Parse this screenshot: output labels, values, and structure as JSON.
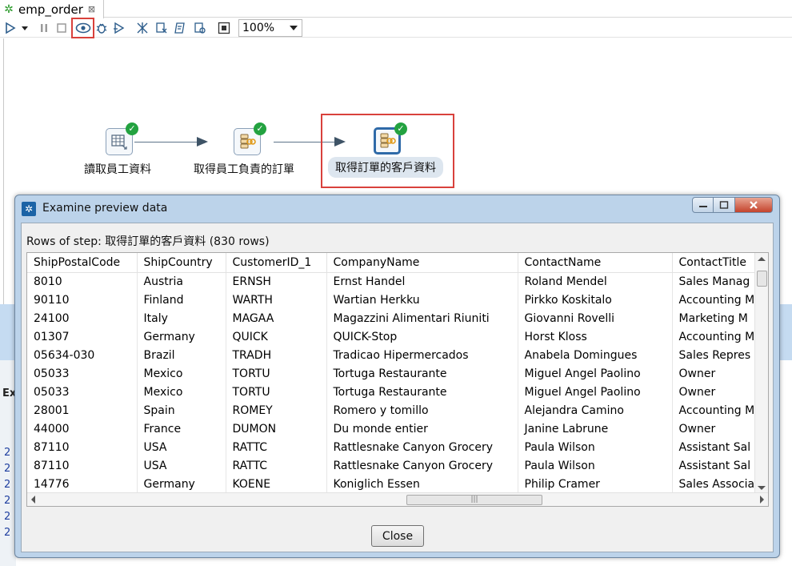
{
  "tab": {
    "title": "emp_order",
    "close": "⊠"
  },
  "toolbar": {
    "zoom": "100%"
  },
  "steps": [
    {
      "label": "讀取員工資料"
    },
    {
      "label": "取得員工負責的訂單"
    },
    {
      "label": "取得訂單的客戶資料"
    }
  ],
  "side_panel": {
    "letters": [
      "Ex",
      "2",
      "2",
      "2",
      "2",
      "2",
      "2"
    ]
  },
  "dialog": {
    "title": "Examine preview data",
    "rows_label": "Rows of step: 取得訂單的客戶資料 (830 rows)",
    "close_label": "Close",
    "columns": [
      "ShipPostalCode",
      "ShipCountry",
      "CustomerID_1",
      "CompanyName",
      "ContactName",
      "ContactTitle"
    ],
    "rows": [
      [
        "8010",
        "Austria",
        "ERNSH",
        "Ernst Handel",
        "Roland Mendel",
        "Sales Manag"
      ],
      [
        "90110",
        "Finland",
        "WARTH",
        "Wartian Herkku",
        "Pirkko Koskitalo",
        "Accounting M"
      ],
      [
        "24100",
        "Italy",
        "MAGAA",
        "Magazzini Alimentari Riuniti",
        "Giovanni Rovelli",
        "Marketing M"
      ],
      [
        "01307",
        "Germany",
        "QUICK",
        "QUICK-Stop",
        "Horst Kloss",
        "Accounting M"
      ],
      [
        "05634-030",
        "Brazil",
        "TRADH",
        "Tradicao Hipermercados",
        "Anabela Domingues",
        "Sales Repres"
      ],
      [
        "05033",
        "Mexico",
        "TORTU",
        "Tortuga Restaurante",
        "Miguel Angel Paolino",
        "Owner"
      ],
      [
        "05033",
        "Mexico",
        "TORTU",
        "Tortuga Restaurante",
        "Miguel Angel Paolino",
        "Owner"
      ],
      [
        "28001",
        "Spain",
        "ROMEY",
        "Romero y tomillo",
        "Alejandra Camino",
        "Accounting M"
      ],
      [
        "44000",
        "France",
        "DUMON",
        "Du monde entier",
        "Janine Labrune",
        "Owner"
      ],
      [
        "87110",
        "USA",
        "RATTC",
        "Rattlesnake Canyon Grocery",
        "Paula Wilson",
        "Assistant Sal"
      ],
      [
        "87110",
        "USA",
        "RATTC",
        "Rattlesnake Canyon Grocery",
        "Paula Wilson",
        "Assistant Sal"
      ],
      [
        "14776",
        "Germany",
        "KOENE",
        "Koniglich Essen",
        "Philip Cramer",
        "Sales Associa"
      ]
    ]
  },
  "colors": {
    "accent": "#2f6aa8",
    "highlight": "#d9413c",
    "ok": "#23a240"
  }
}
